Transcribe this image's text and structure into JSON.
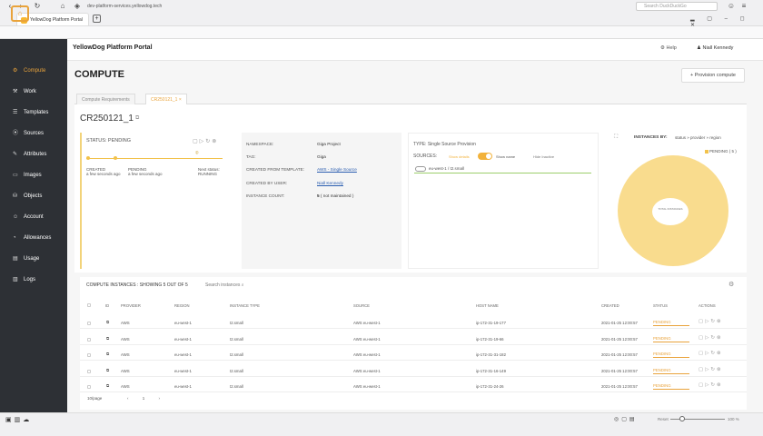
{
  "browser": {
    "tab_title": "YellowDog Platform Portal",
    "url": "dev-platform-services.yellowdog.tech",
    "search_placeholder": "Search DuckDuckGo"
  },
  "header": {
    "title": "YellowDog Platform Portal",
    "help": "Help",
    "user": "Niall Kennedy"
  },
  "sidebar": {
    "items": [
      {
        "label": "Compute",
        "icon": "compute-icon",
        "icon_glyph": "⚙",
        "active": true
      },
      {
        "label": "Work",
        "icon": "work-icon",
        "icon_glyph": "⚒"
      },
      {
        "label": "Templates",
        "icon": "templates-icon",
        "icon_glyph": "☰"
      },
      {
        "label": "Sources",
        "icon": "sources-icon",
        "icon_glyph": "⦿"
      },
      {
        "label": "Attributes",
        "icon": "attributes-icon",
        "icon_glyph": "✎"
      },
      {
        "label": "Images",
        "icon": "images-icon",
        "icon_glyph": "▭"
      },
      {
        "label": "Objects",
        "icon": "objects-icon",
        "icon_glyph": "⛁"
      },
      {
        "label": "Account",
        "icon": "account-icon",
        "icon_glyph": "☺"
      },
      {
        "label": "Allowances",
        "icon": "allowances-icon",
        "icon_glyph": "◔"
      },
      {
        "label": "Usage",
        "icon": "usage-icon",
        "icon_glyph": "▤"
      },
      {
        "label": "Logs",
        "icon": "logs-icon",
        "icon_glyph": "▥"
      }
    ]
  },
  "page": {
    "title": "COMPUTE",
    "provision_button": "+ Provision compute",
    "tabs": [
      {
        "label": "Compute Requirements"
      },
      {
        "label": "CR250121_1  ×"
      }
    ],
    "requirement_id": "CR250121_1"
  },
  "status": {
    "label": "STATUS: PENDING",
    "created_label": "CREATED",
    "created_time": "a few seconds ago",
    "pending_label": "PENDING",
    "pending_time": "a few seconds ago",
    "next_label": "Next status:",
    "next_value": "RUNNING"
  },
  "details": {
    "namespace_label": "NAMESPACE:",
    "namespace": "Giga Project",
    "tag_label": "TAG:",
    "tag": "Giga",
    "template_label": "CREATED FROM TEMPLATE:",
    "template": "AWS - Single Source",
    "user_label": "CREATED BY USER:",
    "user": "Niall Kennedy",
    "count_label": "INSTANCE COUNT:",
    "count": "5",
    "count_note": "( not maintained )"
  },
  "source": {
    "type": "TYPE: Single Source Provision",
    "sources_label": "SOURCES:",
    "show_details": "Show details",
    "show_name": "Show name",
    "hide_inactive": "Hide Inactive",
    "node": "eu-west-1 / t2.small"
  },
  "instances_by": {
    "label": "INSTANCES BY:",
    "value": "status » provider » region",
    "legend": "PENDING ( 5 )",
    "center": "TOTAL INSTANCES"
  },
  "table": {
    "title": "COMPUTE INSTANCES : SHOWING 5 OUT OF 5",
    "search_placeholder": "Search instances",
    "headers": [
      "ID",
      "PROVIDER",
      "REGION",
      "INSTANCE TYPE",
      "SOURCE",
      "HOST NAME",
      "CREATED",
      "STATUS",
      "ACTIONS"
    ],
    "rows": [
      {
        "provider": "AWS",
        "region": "eu-west-1",
        "type": "t2.small",
        "source": "AWS eu-west-1",
        "host": "ip-172-31-19-177",
        "created": "2021-01-25 12:00:57",
        "status": "PENDING"
      },
      {
        "provider": "AWS",
        "region": "eu-west-1",
        "type": "t2.small",
        "source": "AWS eu-west-1",
        "host": "ip-172-31-19-66",
        "created": "2021-01-25 12:00:57",
        "status": "PENDING"
      },
      {
        "provider": "AWS",
        "region": "eu-west-1",
        "type": "t2.small",
        "source": "AWS eu-west-1",
        "host": "ip-172-31-31-182",
        "created": "2021-01-25 12:00:57",
        "status": "PENDING"
      },
      {
        "provider": "AWS",
        "region": "eu-west-1",
        "type": "t2.small",
        "source": "AWS eu-west-1",
        "host": "ip-172-31-16-149",
        "created": "2021-01-25 12:00:57",
        "status": "PENDING"
      },
      {
        "provider": "AWS",
        "region": "eu-west-1",
        "type": "t2.small",
        "source": "AWS eu-west-1",
        "host": "ip-172-31-24-26",
        "created": "2021-01-25 12:00:57",
        "status": "PENDING"
      }
    ],
    "page_size": "10/page",
    "page_nav": "‹ 1 ›"
  },
  "bottom": {
    "reset": "Reset",
    "zoom": "100 %"
  },
  "colors": {
    "accent": "#e9a33b",
    "sidebar": "#2d3035",
    "sunburst": "#f9dc8e"
  }
}
